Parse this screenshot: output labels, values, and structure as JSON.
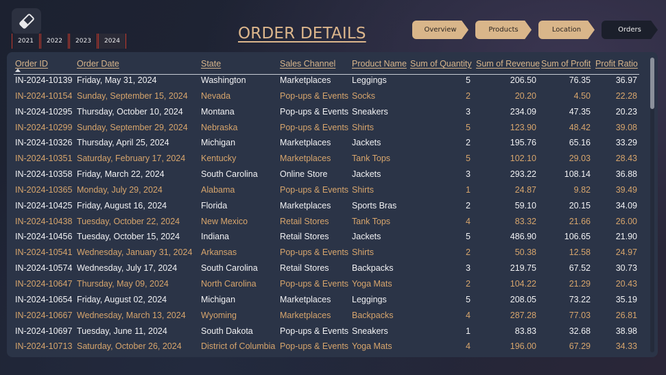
{
  "header": {
    "title": "ORDER DETAILS",
    "logo_icon": "eraser-icon"
  },
  "year_slicer": {
    "years": [
      "2021",
      "2022",
      "2023",
      "2024"
    ],
    "selected": "2024"
  },
  "nav": {
    "buttons": [
      "Overview",
      "Products",
      "Location",
      "Orders"
    ],
    "active": "Orders"
  },
  "colors": {
    "accent": "#d9b68a",
    "panel": "#2b3447",
    "alt_row_text": "#d7a56c"
  },
  "table": {
    "columns": [
      "Order ID",
      "Order Date",
      "State",
      "Sales Channel",
      "Product Name",
      "Sum of Quantity",
      "Sum of Revenue",
      "Sum of Profit",
      "Profit Ratio"
    ],
    "sorted_by": "Order ID",
    "rows": [
      [
        "IN-2024-10139",
        "Friday, May 31, 2024",
        "Washington",
        "Marketplaces",
        "Leggings",
        "5",
        "206.50",
        "76.35",
        "36.97"
      ],
      [
        "IN-2024-10154",
        "Sunday, September 15, 2024",
        "Nevada",
        "Pop-ups & Events",
        "Socks",
        "2",
        "20.20",
        "4.50",
        "22.28"
      ],
      [
        "IN-2024-10295",
        "Thursday, October 10, 2024",
        "Montana",
        "Pop-ups & Events",
        "Sneakers",
        "3",
        "234.09",
        "47.35",
        "20.23"
      ],
      [
        "IN-2024-10299",
        "Sunday, September 29, 2024",
        "Nebraska",
        "Pop-ups & Events",
        "Shirts",
        "5",
        "123.90",
        "48.42",
        "39.08"
      ],
      [
        "IN-2024-10326",
        "Thursday, April 25, 2024",
        "Michigan",
        "Marketplaces",
        "Jackets",
        "2",
        "195.76",
        "65.16",
        "33.29"
      ],
      [
        "IN-2024-10351",
        "Saturday, February 17, 2024",
        "Kentucky",
        "Marketplaces",
        "Tank Tops",
        "5",
        "102.10",
        "29.03",
        "28.43"
      ],
      [
        "IN-2024-10358",
        "Friday, March 22, 2024",
        "South Carolina",
        "Online Store",
        "Jackets",
        "3",
        "293.22",
        "108.14",
        "36.88"
      ],
      [
        "IN-2024-10365",
        "Monday, July 29, 2024",
        "Alabama",
        "Pop-ups & Events",
        "Shirts",
        "1",
        "24.87",
        "9.82",
        "39.49"
      ],
      [
        "IN-2024-10425",
        "Friday, August 16, 2024",
        "Florida",
        "Marketplaces",
        "Sports Bras",
        "2",
        "59.10",
        "20.15",
        "34.09"
      ],
      [
        "IN-2024-10438",
        "Tuesday, October 22, 2024",
        "New Mexico",
        "Retail Stores",
        "Tank Tops",
        "4",
        "83.32",
        "21.66",
        "26.00"
      ],
      [
        "IN-2024-10456",
        "Tuesday, October 15, 2024",
        "Indiana",
        "Retail Stores",
        "Jackets",
        "5",
        "486.90",
        "106.65",
        "21.90"
      ],
      [
        "IN-2024-10541",
        "Wednesday, January 31, 2024",
        "Arkansas",
        "Pop-ups & Events",
        "Shirts",
        "2",
        "50.38",
        "12.58",
        "24.97"
      ],
      [
        "IN-2024-10574",
        "Wednesday, July 17, 2024",
        "South Carolina",
        "Retail Stores",
        "Backpacks",
        "3",
        "219.75",
        "67.52",
        "30.73"
      ],
      [
        "IN-2024-10647",
        "Thursday, May 09, 2024",
        "North Carolina",
        "Pop-ups & Events",
        "Yoga Mats",
        "2",
        "104.22",
        "21.29",
        "20.43"
      ],
      [
        "IN-2024-10654",
        "Friday, August 02, 2024",
        "Michigan",
        "Marketplaces",
        "Leggings",
        "5",
        "208.05",
        "73.22",
        "35.19"
      ],
      [
        "IN-2024-10667",
        "Wednesday, March 13, 2024",
        "Wyoming",
        "Marketplaces",
        "Backpacks",
        "4",
        "287.28",
        "77.03",
        "26.81"
      ],
      [
        "IN-2024-10697",
        "Tuesday, June 11, 2024",
        "South Dakota",
        "Pop-ups & Events",
        "Sneakers",
        "1",
        "83.83",
        "32.68",
        "38.98"
      ],
      [
        "IN-2024-10713",
        "Saturday, October 26, 2024",
        "District of Columbia",
        "Pop-ups & Events",
        "Yoga Mats",
        "4",
        "196.00",
        "67.29",
        "34.33"
      ]
    ]
  }
}
